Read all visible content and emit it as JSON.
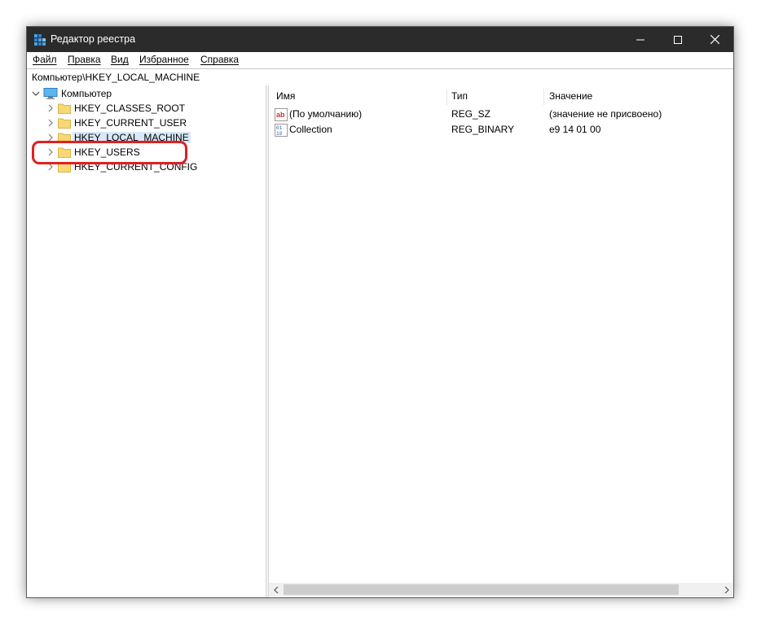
{
  "window": {
    "title": "Редактор реестра",
    "controls": {
      "minimize": "minimize-icon",
      "maximize": "maximize-icon",
      "close": "close-icon"
    }
  },
  "menu": [
    "Файл",
    "Правка",
    "Вид",
    "Избранное",
    "Справка"
  ],
  "address": "Компьютер\\HKEY_LOCAL_MACHINE",
  "tree": {
    "root": "Компьютер",
    "items": [
      {
        "label": "HKEY_CLASSES_ROOT"
      },
      {
        "label": "HKEY_CURRENT_USER"
      },
      {
        "label": "HKEY_LOCAL_MACHINE",
        "selected": true
      },
      {
        "label": "HKEY_USERS",
        "highlighted": true
      },
      {
        "label": "HKEY_CURRENT_CONFIG"
      }
    ]
  },
  "list": {
    "columns": [
      "Имя",
      "Тип",
      "Значение"
    ],
    "rows": [
      {
        "icon": "string-value-icon",
        "name": "(По умолчанию)",
        "type": "REG_SZ",
        "value": "(значение не присвоено)"
      },
      {
        "icon": "binary-value-icon",
        "name": "Collection",
        "type": "REG_BINARY",
        "value": "e9 14 01 00"
      }
    ]
  },
  "colors": {
    "titlebar": "#2b2b2b",
    "selection": "#d9e8f7",
    "highlight": "#e02020",
    "folder": "#f8d775"
  }
}
